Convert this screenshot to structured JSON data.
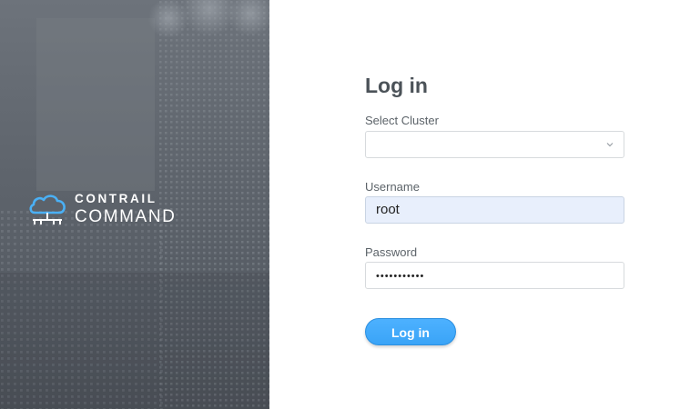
{
  "brand": {
    "line1": "CONTRAIL",
    "line2": "COMMAND"
  },
  "form": {
    "title": "Log in",
    "cluster_label": "Select Cluster",
    "cluster_value": "",
    "username_label": "Username",
    "username_value": "root",
    "password_label": "Password",
    "password_value": "•••••••••••",
    "submit_label": "Log in"
  },
  "colors": {
    "accent": "#3aa4f7",
    "brand_icon": "#4ab0f5",
    "panel_bg": "#5f656d",
    "title": "#4b5258",
    "autofill_bg": "#e8effc"
  },
  "icons": {
    "brand_logo": "cloud-network-icon",
    "select_arrow": "chevron-down-icon"
  }
}
